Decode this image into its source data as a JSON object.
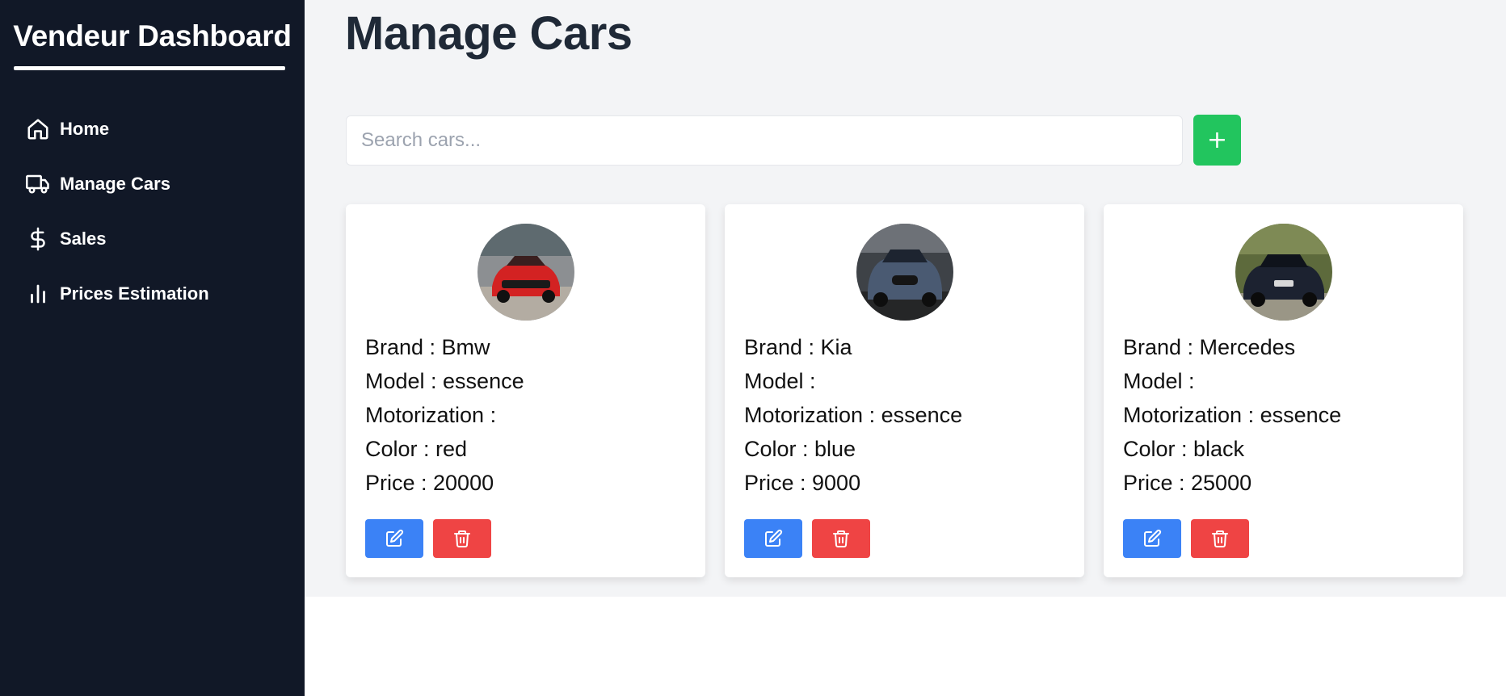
{
  "sidebar": {
    "title": "Vendeur Dashboard",
    "items": [
      {
        "label": "Home",
        "icon": "home-icon"
      },
      {
        "label": "Manage Cars",
        "icon": "truck-icon"
      },
      {
        "label": "Sales",
        "icon": "dollar-icon"
      },
      {
        "label": "Prices Estimation",
        "icon": "bar-chart-icon"
      }
    ]
  },
  "main": {
    "title": "Manage Cars",
    "search": {
      "placeholder": "Search cars...",
      "value": ""
    },
    "add_button_label": "+",
    "cars": [
      {
        "brand": "Brand : Bmw",
        "model": "Model : essence",
        "motorization": "Motorization :",
        "color": "Color : red",
        "price": "Price : 20000",
        "car_color": "#d32222"
      },
      {
        "brand": "Brand : Kia",
        "model": "Model :",
        "motorization": "Motorization : essence",
        "color": "Color : blue",
        "price": "Price : 9000",
        "car_color": "#4a5a72"
      },
      {
        "brand": "Brand : Mercedes",
        "model": "Model :",
        "motorization": "Motorization : essence",
        "color": "Color : black",
        "price": "Price : 25000",
        "car_color": "#1c2230"
      }
    ]
  },
  "colors": {
    "sidebar_bg": "#111827",
    "main_bg": "#f3f4f6",
    "add_button": "#22c55e",
    "edit_button": "#3b82f6",
    "delete_button": "#ef4444"
  },
  "icons": {
    "add": "plus-icon",
    "edit": "edit-icon",
    "delete": "trash-icon"
  }
}
